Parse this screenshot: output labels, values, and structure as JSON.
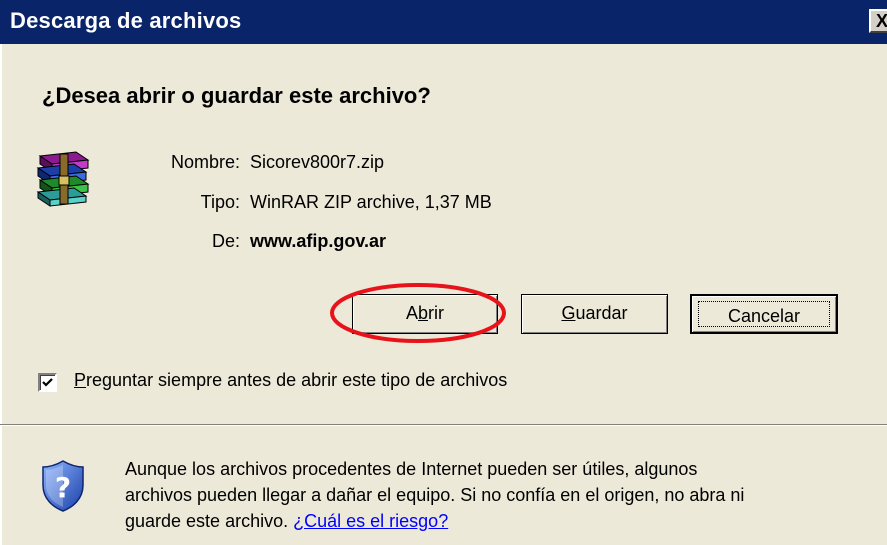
{
  "window": {
    "title": "Descarga de archivos",
    "close_label": "X"
  },
  "dialog": {
    "question": "¿Desea abrir o guardar este archivo?",
    "file": {
      "name_label": "Nombre:",
      "name_value": "Sicorev800r7.zip",
      "type_label": "Tipo:",
      "type_value": "WinRAR ZIP archive, 1,37 MB",
      "from_label": "De:",
      "from_value": "www.afip.gov.ar",
      "icon": "winrar-archive-icon"
    },
    "buttons": {
      "open": {
        "prefix": "A",
        "accel": "b",
        "suffix": "rir"
      },
      "save": {
        "prefix": "",
        "accel": "G",
        "suffix": "uardar"
      },
      "cancel": {
        "label": "Cancelar"
      }
    },
    "checkbox": {
      "checked": true,
      "accel": "P",
      "label_rest": "reguntar siempre antes de abrir este tipo de archivos"
    },
    "warning": {
      "icon": "security-shield-question-icon",
      "text": "Aunque los archivos procedentes de Internet pueden ser útiles, algunos archivos pueden llegar a dañar el equipo. Si no confía en el origen, no abra ni guarde este archivo.",
      "link": "¿Cuál es el riesgo?"
    },
    "annotation": {
      "color": "#e8131a"
    }
  },
  "colors": {
    "titlebar": "#0a246a",
    "dialog_bg": "#ece9d8",
    "link": "#0000ff"
  }
}
